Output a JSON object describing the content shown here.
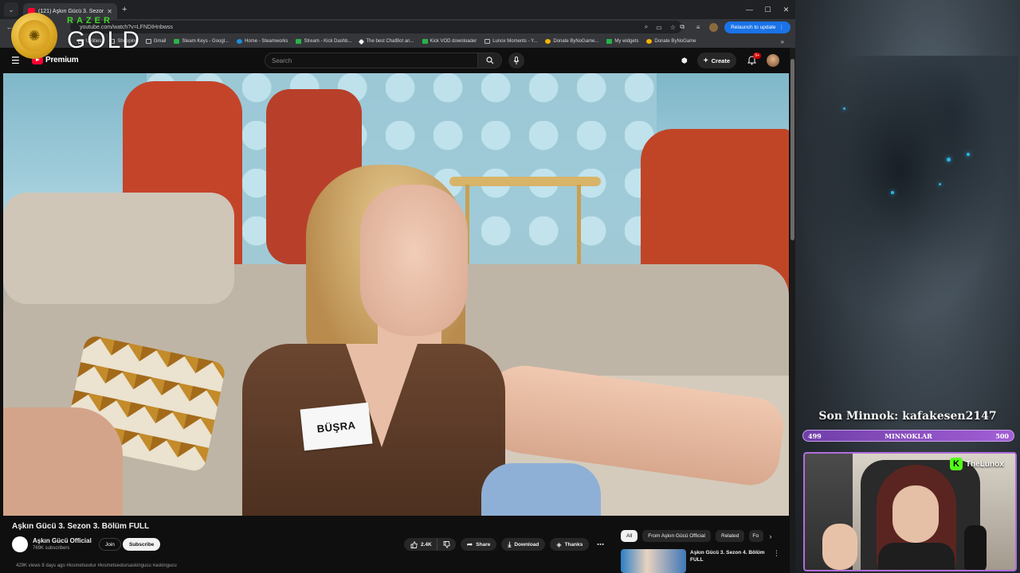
{
  "browser": {
    "tab_title": "(121) Aşkın Gücü 3. Sezon",
    "url": "youtube.com/watch?v=LFNDIHnbwss",
    "relaunch_label": "Relaunch to update",
    "bookmarks": [
      {
        "label": "Shopping",
        "icon": "folder"
      },
      {
        "label": "Gmail",
        "icon": "folder"
      },
      {
        "label": "Steam Keys - Googl...",
        "icon": "sheet"
      },
      {
        "label": "Home - Steamworks",
        "icon": "steam"
      },
      {
        "label": "Stream - Kick Dashb...",
        "icon": "kick"
      },
      {
        "label": "The best ChatBot an...",
        "icon": "bot"
      },
      {
        "label": "Kick VOD downloader",
        "icon": "kick"
      },
      {
        "label": "Lunox Moments - Y...",
        "icon": "folder"
      },
      {
        "label": "Donate ByNoGame...",
        "icon": "coin"
      },
      {
        "label": "My widgets",
        "icon": "sheet"
      },
      {
        "label": "Donate ByNoGame",
        "icon": "coin"
      }
    ],
    "bookmarks_partial": [
      "Utilities"
    ]
  },
  "razer": {
    "brand": "RAZER",
    "tier": "GOLD"
  },
  "youtube": {
    "logo_text": "Premium",
    "search_placeholder": "Search",
    "create_label": "Create",
    "notification_count": "9+",
    "video": {
      "nametag": "BÜŞRA",
      "title": "Aşkın Gücü 3. Sezon 3. Bölüm FULL",
      "channel": "Aşkın Gücü Official",
      "subscribers": "769K subscribers",
      "join_label": "Join",
      "subscribe_label": "Subscribe",
      "likes": "2.4K",
      "share_label": "Share",
      "download_label": "Download",
      "thanks_label": "Thanks",
      "description_preview": "429K views  8 days ago  #kısmetseolur #kısmetseolursaskingucu #askingucu"
    },
    "chips": [
      "All",
      "From Aşkın Gücü Official",
      "Related",
      "Fo"
    ],
    "related": {
      "title": "Aşkın Gücü 3. Sezon 4. Bölüm FULL"
    }
  },
  "overlay": {
    "minnok_title": "Son Minnok: kafakesen2147",
    "minnok_label": "MINNOKLAR",
    "minnok_current": "499",
    "minnok_goal": "500",
    "minnok_progress": 0.998,
    "kick_name": "TheLunox",
    "accent": "#a35fd6",
    "kick_color": "#53fc18"
  }
}
